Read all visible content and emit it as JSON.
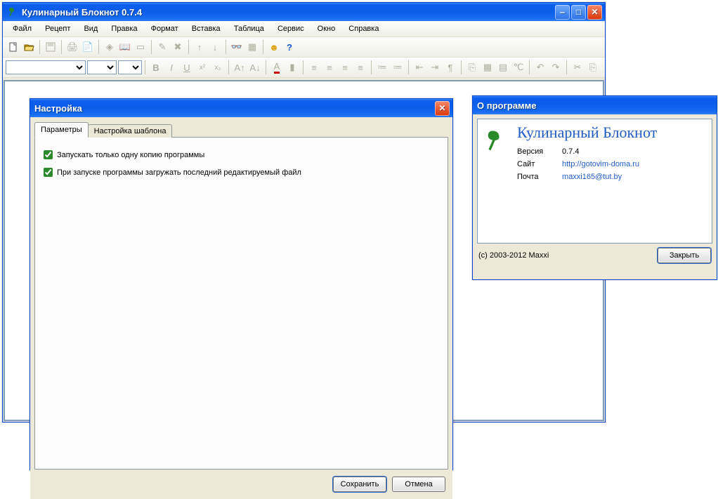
{
  "main": {
    "title": "Кулинарный Блокнот 0.7.4",
    "menu": [
      "Файл",
      "Рецепт",
      "Вид",
      "Правка",
      "Формат",
      "Вставка",
      "Таблица",
      "Сервис",
      "Окно",
      "Справка"
    ]
  },
  "settings_dialog": {
    "title": "Настройка",
    "tabs": {
      "params": "Параметры",
      "template": "Настройка шаблона"
    },
    "opt_single_instance": "Запускать только одну копию программы",
    "opt_load_last_file": "При запуске программы загружать последний редактируемый файл",
    "save": "Сохранить",
    "cancel": "Отмена"
  },
  "about_dialog": {
    "title": "О программе",
    "app_name": "Кулинарный Блокнот",
    "version_label": "Версия",
    "version_value": "0.7.4",
    "site_label": "Сайт",
    "site_value": "http://gotovim-doma.ru",
    "mail_label": "Почта",
    "mail_value": "maxxi165@tut.by",
    "copyright": "(c) 2003-2012 Maxxi",
    "close": "Закрыть"
  }
}
